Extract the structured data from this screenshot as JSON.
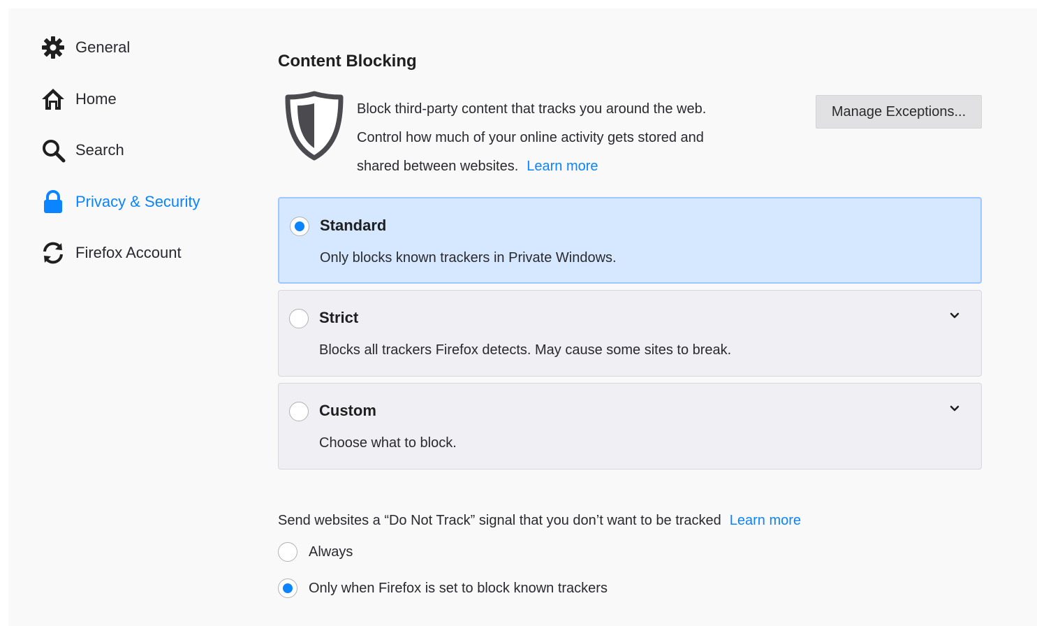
{
  "sidebar": {
    "items": [
      {
        "label": "General",
        "icon": "gear-icon"
      },
      {
        "label": "Home",
        "icon": "home-icon"
      },
      {
        "label": "Search",
        "icon": "search-icon"
      },
      {
        "label": "Privacy & Security",
        "icon": "lock-icon",
        "active": true
      },
      {
        "label": "Firefox Account",
        "icon": "sync-icon"
      }
    ]
  },
  "content_blocking": {
    "title": "Content Blocking",
    "description_line1": "Block third-party content that tracks you around the web.",
    "description_line2": "Control how much of your online activity gets stored and",
    "description_line3": "shared between websites.",
    "learn_more": "Learn more",
    "manage_exceptions": "Manage Exceptions...",
    "options": [
      {
        "title": "Standard",
        "description": "Only blocks known trackers in Private Windows.",
        "selected": true
      },
      {
        "title": "Strict",
        "description": "Blocks all trackers Firefox detects. May cause some sites to break.",
        "selected": false
      },
      {
        "title": "Custom",
        "description": "Choose what to block.",
        "selected": false
      }
    ]
  },
  "do_not_track": {
    "label": "Send websites a “Do Not Track” signal that you don’t want to be tracked",
    "learn_more": "Learn more",
    "options": [
      {
        "label": "Always",
        "checked": false
      },
      {
        "label": "Only when Firefox is set to block known trackers",
        "checked": true
      }
    ]
  },
  "colors": {
    "accent": "#0a84ff",
    "selected_card_bg": "#d6e8ff",
    "card_bg": "#f0f0f4",
    "button_bg": "#e1e1e3"
  }
}
